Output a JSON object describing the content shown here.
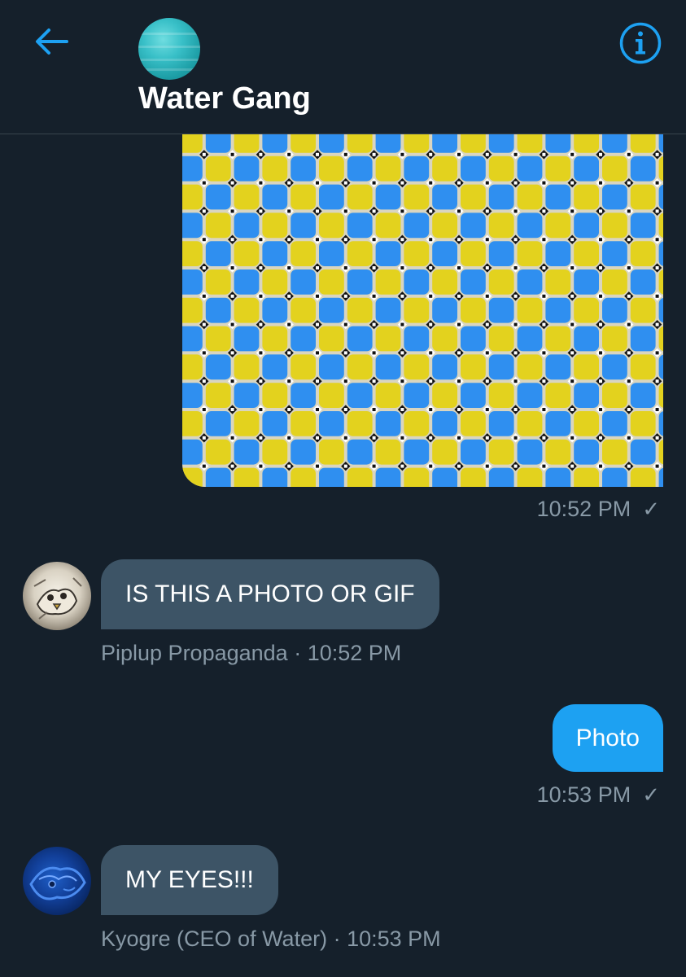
{
  "header": {
    "title": "Water Gang",
    "back_icon": "arrow-left-icon",
    "info_icon": "info-circle-icon",
    "accent_color": "#1da1f2"
  },
  "messages": [
    {
      "kind": "photo",
      "direction": "outgoing",
      "time": "10:52 PM",
      "status_icon": "check-icon",
      "image_colors": {
        "yellow": "#e3d21e",
        "blue": "#2f8ff0",
        "black": "#111111",
        "white": "#ffffff"
      }
    },
    {
      "kind": "text",
      "direction": "incoming",
      "text": "IS THIS A PHOTO OR GIF",
      "sender": "Piplup Propaganda",
      "separator": "·",
      "time": "10:52 PM"
    },
    {
      "kind": "text",
      "direction": "outgoing",
      "text": "Photo",
      "time": "10:53 PM",
      "status_icon": "check-icon"
    },
    {
      "kind": "text",
      "direction": "incoming",
      "text": "MY EYES!!!",
      "sender": "Kyogre (CEO of Water)",
      "separator": "·",
      "time": "10:53 PM"
    }
  ],
  "colors": {
    "background": "#15202b",
    "incoming_bubble": "#3d5466",
    "outgoing_bubble": "#1da1f2",
    "meta_text": "#8899a6"
  }
}
